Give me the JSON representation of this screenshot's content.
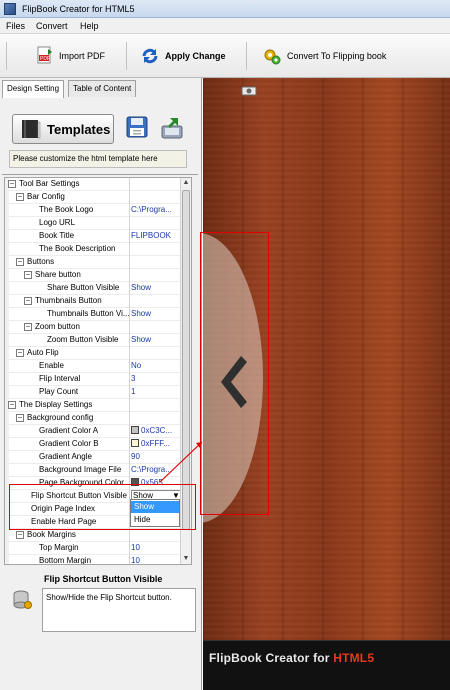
{
  "window": {
    "title": "FlipBook Creator for HTML5"
  },
  "menu": [
    "Files",
    "Convert",
    "Help"
  ],
  "toolbar": {
    "import_label": "Import PDF",
    "apply_label": "Apply Change",
    "convert_label": "Convert To Flipping book"
  },
  "tabs": [
    "Design Setting",
    "Table of Content"
  ],
  "templates_label": "Templates",
  "hint": "Please customize the html template here",
  "properties": [
    {
      "level": 0,
      "expander": "⊟",
      "name": "Tool Bar Settings",
      "value": ""
    },
    {
      "level": 1,
      "expander": "⊟",
      "name": "Bar Config",
      "value": ""
    },
    {
      "level": 2,
      "expander": "",
      "name": "The Book Logo",
      "value": "C:\\Progra..."
    },
    {
      "level": 2,
      "expander": "",
      "name": "Logo URL",
      "value": ""
    },
    {
      "level": 2,
      "expander": "",
      "name": "Book Title",
      "value": "FLIPBOOK"
    },
    {
      "level": 2,
      "expander": "",
      "name": "The Book Description",
      "value": ""
    },
    {
      "level": 1,
      "expander": "⊟",
      "name": "Buttons",
      "value": ""
    },
    {
      "level": 2,
      "expander": "⊟",
      "name": "Share button",
      "value": ""
    },
    {
      "level": 3,
      "expander": "",
      "name": "Share Button Visible",
      "value": "Show"
    },
    {
      "level": 2,
      "expander": "⊟",
      "name": "Thumbnails Button",
      "value": ""
    },
    {
      "level": 3,
      "expander": "",
      "name": "Thumbnails Button Vi...",
      "value": "Show"
    },
    {
      "level": 2,
      "expander": "⊟",
      "name": "Zoom button",
      "value": ""
    },
    {
      "level": 3,
      "expander": "",
      "name": "Zoom Button Visible",
      "value": "Show"
    },
    {
      "level": 1,
      "expander": "⊟",
      "name": "Auto Flip",
      "value": ""
    },
    {
      "level": 2,
      "expander": "",
      "name": "Enable",
      "value": "No"
    },
    {
      "level": 2,
      "expander": "",
      "name": "Flip Interval",
      "value": "3"
    },
    {
      "level": 2,
      "expander": "",
      "name": "Play Count",
      "value": "1"
    },
    {
      "level": 0,
      "expander": "⊟",
      "name": "The Display Settings",
      "value": ""
    },
    {
      "level": 1,
      "expander": "⊟",
      "name": "Background config",
      "value": ""
    },
    {
      "level": 2,
      "expander": "",
      "name": "Gradient Color A",
      "value": "0xC3C...",
      "swatch": "#c3c3c3"
    },
    {
      "level": 2,
      "expander": "",
      "name": "Gradient Color B",
      "value": "0xFFF...",
      "swatch": "#fff8d8"
    },
    {
      "level": 2,
      "expander": "",
      "name": "Gradient Angle",
      "value": "90"
    },
    {
      "level": 2,
      "expander": "",
      "name": "Background Image File",
      "value": "C:\\Progra..."
    },
    {
      "level": 2,
      "expander": "",
      "name": "Page Background Color",
      "value": "0x565...",
      "swatch": "#565656"
    },
    {
      "level": 1,
      "expander": "",
      "name": "Flip Shortcut Button Visible",
      "value": "Show"
    },
    {
      "level": 1,
      "expander": "",
      "name": "Origin Page Index",
      "value": ""
    },
    {
      "level": 1,
      "expander": "",
      "name": "Enable Hard Page",
      "value": ""
    },
    {
      "level": 1,
      "expander": "⊟",
      "name": "Book Margins",
      "value": ""
    },
    {
      "level": 2,
      "expander": "",
      "name": "Top Margin",
      "value": "10"
    },
    {
      "level": 2,
      "expander": "",
      "name": "Bottom Margin",
      "value": "10"
    }
  ],
  "dropdown_options": [
    "Show",
    "Hide"
  ],
  "description": {
    "title": "Flip Shortcut Button Visible",
    "text": "Show/Hide the Flip Shortcut button."
  },
  "brand": {
    "main": "FlipBook Creator for ",
    "accent": "HTML5"
  },
  "colors": {
    "accent_red": "#e00000",
    "selection_blue": "#3399ff",
    "value_blue": "#1a3aa8"
  }
}
